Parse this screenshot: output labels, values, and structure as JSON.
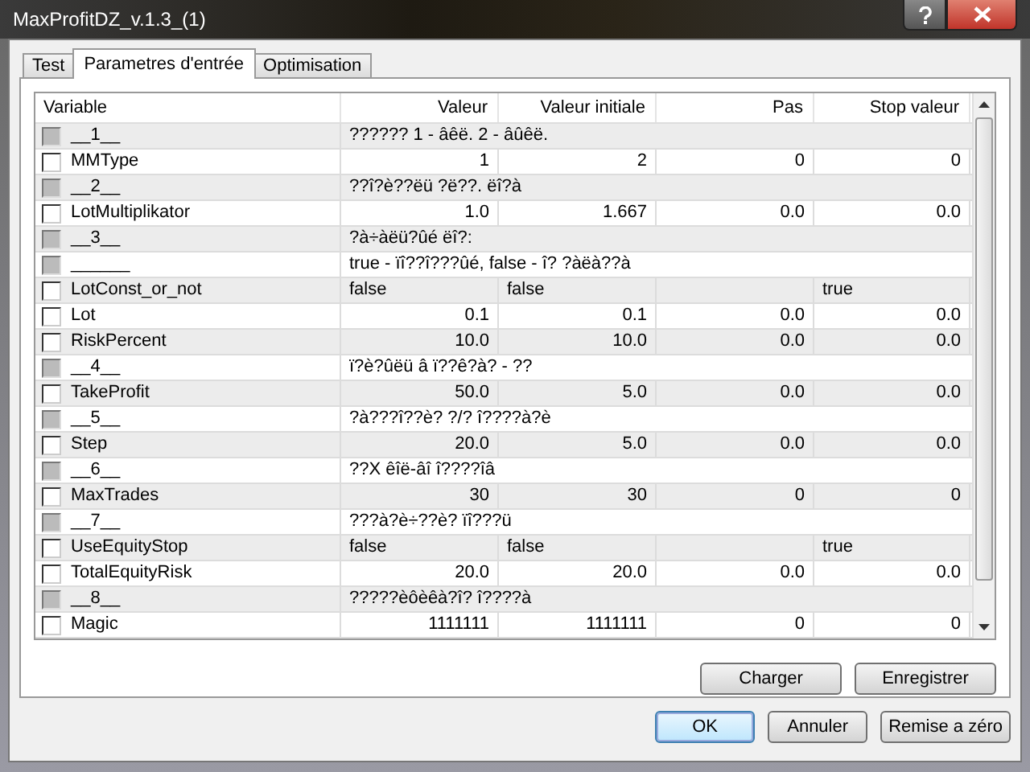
{
  "window": {
    "title": "MaxProfitDZ_v.1.3_(1)"
  },
  "tabs": [
    {
      "label": "Test",
      "selected": false
    },
    {
      "label": "Parametres d'entrée",
      "selected": true
    },
    {
      "label": "Optimisation",
      "selected": false
    }
  ],
  "table": {
    "columns": [
      "Variable",
      "Valeur",
      "Valeur initiale",
      "Pas",
      "Stop valeur"
    ],
    "rows": [
      {
        "kind": "section",
        "checked": false,
        "name": "__1__",
        "description": "?????? 1 - âêë. 2 - âûêë."
      },
      {
        "kind": "number",
        "checked": false,
        "name": "MMType",
        "values": [
          "1",
          "2",
          "0",
          "0"
        ]
      },
      {
        "kind": "section",
        "checked": false,
        "name": "__2__",
        "description": "??î?è??ëü ?ë??. ëî?à"
      },
      {
        "kind": "number",
        "checked": false,
        "name": "LotMultiplikator",
        "values": [
          "1.0",
          "1.667",
          "0.0",
          "0.0"
        ]
      },
      {
        "kind": "section",
        "checked": false,
        "name": "__3__",
        "description": "?à÷àëü?ûé ëî?:"
      },
      {
        "kind": "section",
        "checked": false,
        "name": "______",
        "description": "true - ïî??î???ûé, false - î? ?àëà??à"
      },
      {
        "kind": "bool",
        "checked": false,
        "name": "LotConst_or_not",
        "values": [
          "false",
          "false",
          "true"
        ]
      },
      {
        "kind": "number",
        "checked": false,
        "name": "Lot",
        "values": [
          "0.1",
          "0.1",
          "0.0",
          "0.0"
        ]
      },
      {
        "kind": "number",
        "checked": false,
        "name": "RiskPercent",
        "values": [
          "10.0",
          "10.0",
          "0.0",
          "0.0"
        ]
      },
      {
        "kind": "section",
        "checked": false,
        "name": "__4__",
        "description": "ï?è?ûëü â ï??ê?à? - ??"
      },
      {
        "kind": "number",
        "checked": false,
        "name": "TakeProfit",
        "values": [
          "50.0",
          "5.0",
          "0.0",
          "0.0"
        ]
      },
      {
        "kind": "section",
        "checked": false,
        "name": "__5__",
        "description": "?à???î??è? ?/? î????à?è"
      },
      {
        "kind": "number",
        "checked": false,
        "name": "Step",
        "values": [
          "20.0",
          "5.0",
          "0.0",
          "0.0"
        ]
      },
      {
        "kind": "section",
        "checked": false,
        "name": "__6__",
        "description": "??X êîë-âî î????îâ"
      },
      {
        "kind": "number",
        "checked": false,
        "name": "MaxTrades",
        "values": [
          "30",
          "30",
          "0",
          "0"
        ]
      },
      {
        "kind": "section",
        "checked": false,
        "name": "__7__",
        "description": "???à?è÷??è? ïî???ü"
      },
      {
        "kind": "bool",
        "checked": false,
        "name": "UseEquityStop",
        "values": [
          "false",
          "false",
          "true"
        ]
      },
      {
        "kind": "number",
        "checked": false,
        "name": "TotalEquityRisk",
        "values": [
          "20.0",
          "20.0",
          "0.0",
          "0.0"
        ]
      },
      {
        "kind": "section",
        "checked": false,
        "name": "__8__",
        "description": "?????èôèêà?î? î????à"
      },
      {
        "kind": "number",
        "checked": false,
        "name": "Magic",
        "values": [
          "1111111",
          "1111111",
          "0",
          "0"
        ]
      }
    ]
  },
  "panel_buttons": [
    "Charger",
    "Enregistrer"
  ],
  "dialog_buttons": [
    {
      "label": "OK",
      "selected": true
    },
    {
      "label": "Annuler",
      "selected": false
    },
    {
      "label": "Remise a zéro",
      "selected": false
    }
  ]
}
